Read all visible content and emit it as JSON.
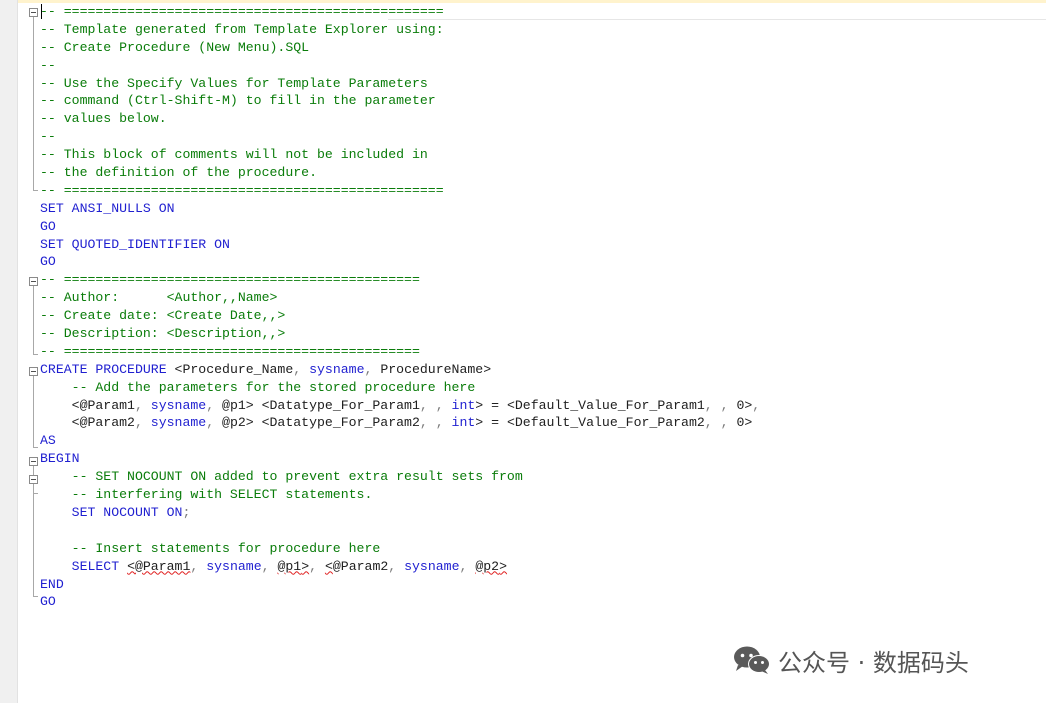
{
  "editor": {
    "lines": [
      [
        {
          "s": "c",
          "t": "-- ================================================"
        }
      ],
      [
        {
          "s": "c",
          "t": "-- Template generated from Template Explorer using:"
        }
      ],
      [
        {
          "s": "c",
          "t": "-- Create Procedure (New Menu).SQL"
        }
      ],
      [
        {
          "s": "c",
          "t": "--"
        }
      ],
      [
        {
          "s": "c",
          "t": "-- Use the Specify Values for Template Parameters"
        }
      ],
      [
        {
          "s": "c",
          "t": "-- command (Ctrl-Shift-M) to fill in the parameter"
        }
      ],
      [
        {
          "s": "c",
          "t": "-- values below."
        }
      ],
      [
        {
          "s": "c",
          "t": "--"
        }
      ],
      [
        {
          "s": "c",
          "t": "-- This block of comments will not be included in"
        }
      ],
      [
        {
          "s": "c",
          "t": "-- the definition of the procedure."
        }
      ],
      [
        {
          "s": "c",
          "t": "-- ================================================"
        }
      ],
      [
        {
          "s": "k",
          "t": "SET ANSI_NULLS ON"
        }
      ],
      [
        {
          "s": "k",
          "t": "GO"
        }
      ],
      [
        {
          "s": "k",
          "t": "SET QUOTED_IDENTIFIER ON"
        }
      ],
      [
        {
          "s": "k",
          "t": "GO"
        }
      ],
      [
        {
          "s": "c",
          "t": "-- ============================================="
        }
      ],
      [
        {
          "s": "c",
          "t": "-- Author:      <Author,,Name>"
        }
      ],
      [
        {
          "s": "c",
          "t": "-- Create date: <Create Date,,>"
        }
      ],
      [
        {
          "s": "c",
          "t": "-- Description: <Description,,>"
        }
      ],
      [
        {
          "s": "c",
          "t": "-- ============================================="
        }
      ],
      [
        {
          "s": "k",
          "t": "CREATE PROCEDURE "
        },
        {
          "s": "t",
          "t": "<Procedure_Name"
        },
        {
          "s": "g",
          "t": ", "
        },
        {
          "s": "k",
          "t": "sysname"
        },
        {
          "s": "g",
          "t": ", "
        },
        {
          "s": "t",
          "t": "ProcedureName>"
        }
      ],
      [
        {
          "s": "t",
          "t": "    "
        },
        {
          "s": "c",
          "t": "-- Add the parameters for the stored procedure here"
        }
      ],
      [
        {
          "s": "t",
          "t": "    <@Param1"
        },
        {
          "s": "g",
          "t": ", "
        },
        {
          "s": "k",
          "t": "sysname"
        },
        {
          "s": "g",
          "t": ", "
        },
        {
          "s": "t",
          "t": "@p1> <Datatype_For_Param1"
        },
        {
          "s": "g",
          "t": ", , "
        },
        {
          "s": "k",
          "t": "int"
        },
        {
          "s": "t",
          "t": "> = <Default_Value_For_Param1"
        },
        {
          "s": "g",
          "t": ", , "
        },
        {
          "s": "t",
          "t": "0>"
        },
        {
          "s": "g",
          "t": ","
        }
      ],
      [
        {
          "s": "t",
          "t": "    <@Param2"
        },
        {
          "s": "g",
          "t": ", "
        },
        {
          "s": "k",
          "t": "sysname"
        },
        {
          "s": "g",
          "t": ", "
        },
        {
          "s": "t",
          "t": "@p2> <Datatype_For_Param2"
        },
        {
          "s": "g",
          "t": ", , "
        },
        {
          "s": "k",
          "t": "int"
        },
        {
          "s": "t",
          "t": "> = <Default_Value_For_Param2"
        },
        {
          "s": "g",
          "t": ", , "
        },
        {
          "s": "t",
          "t": "0>"
        }
      ],
      [
        {
          "s": "k",
          "t": "AS"
        }
      ],
      [
        {
          "s": "k",
          "t": "BEGIN"
        }
      ],
      [
        {
          "s": "t",
          "t": "    "
        },
        {
          "s": "c",
          "t": "-- SET NOCOUNT ON added to prevent extra result sets from"
        }
      ],
      [
        {
          "s": "t",
          "t": "    "
        },
        {
          "s": "c",
          "t": "-- interfering with SELECT statements."
        }
      ],
      [
        {
          "s": "t",
          "t": "    "
        },
        {
          "s": "k",
          "t": "SET NOCOUNT ON"
        },
        {
          "s": "g",
          "t": ";"
        }
      ],
      [
        {
          "s": "t",
          "t": ""
        }
      ],
      [
        {
          "s": "t",
          "t": "    "
        },
        {
          "s": "c",
          "t": "-- Insert statements for procedure here"
        }
      ],
      [
        {
          "s": "t",
          "t": "    "
        },
        {
          "s": "k",
          "t": "SELECT "
        },
        {
          "s": "t",
          "t": "<",
          "q": true
        },
        {
          "s": "t",
          "t": "@Param1",
          "q": true
        },
        {
          "s": "g",
          "t": ", "
        },
        {
          "s": "k",
          "t": "sysname"
        },
        {
          "s": "g",
          "t": ", "
        },
        {
          "s": "t",
          "t": "@p1",
          "q": true
        },
        {
          "s": "t",
          "t": ">",
          "q": true
        },
        {
          "s": "g",
          "t": ", "
        },
        {
          "s": "t",
          "t": "<",
          "q": true
        },
        {
          "s": "t",
          "t": "@Param2"
        },
        {
          "s": "g",
          "t": ", "
        },
        {
          "s": "k",
          "t": "sysname"
        },
        {
          "s": "g",
          "t": ", "
        },
        {
          "s": "t",
          "t": "@p2",
          "q": true
        },
        {
          "s": "t",
          "t": ">",
          "q": true
        }
      ],
      [
        {
          "s": "k",
          "t": "END"
        }
      ],
      [
        {
          "s": "k",
          "t": "GO"
        }
      ]
    ]
  },
  "icons": {
    "fold_marker": "collapse-minus-icon",
    "watermark_logo": "wechat-icon"
  },
  "watermark": {
    "text": "公众号 · 数据码头"
  },
  "colors": {
    "comment": "#0a7c0a",
    "keyword": "#1f1fd0",
    "punctuation": "#7b7b7b",
    "text": "#202020",
    "squiggle": "#e02020"
  }
}
